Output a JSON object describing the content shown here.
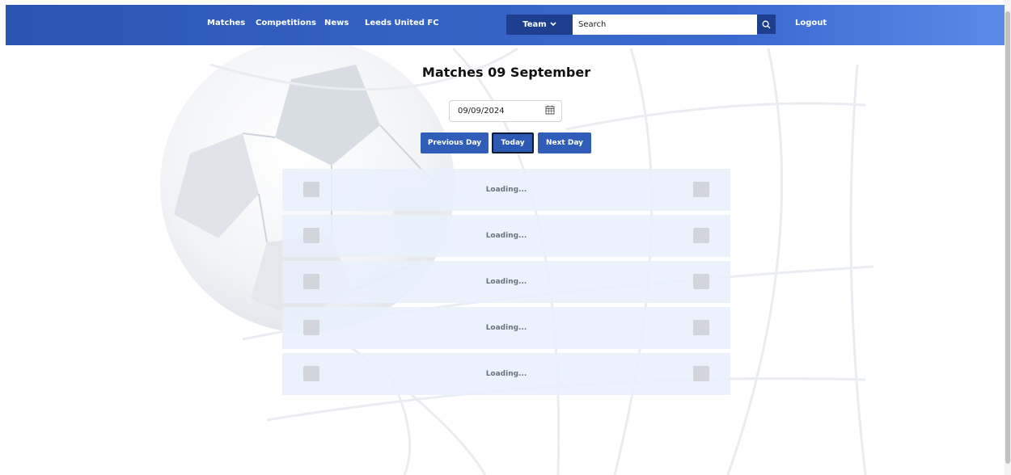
{
  "nav": {
    "links": [
      "Matches",
      "Competitions",
      "News",
      "Leeds United FC"
    ],
    "team_label": "Team",
    "search_placeholder": "Search",
    "logout_label": "Logout"
  },
  "page": {
    "title": "Matches 09 September",
    "date_value": "09/09/2024",
    "buttons": {
      "previous": "Previous Day",
      "today": "Today",
      "next": "Next Day"
    }
  },
  "matches": [
    {
      "status": "Loading..."
    },
    {
      "status": "Loading..."
    },
    {
      "status": "Loading..."
    },
    {
      "status": "Loading..."
    },
    {
      "status": "Loading..."
    }
  ],
  "icons": {
    "team": "chevron-down-icon",
    "search": "search-icon",
    "date": "calendar-icon"
  },
  "colors": {
    "nav_start": "#2a56b2",
    "nav_end": "#5a8be8",
    "button": "#2f5db8",
    "dark_button": "#1e3f8e",
    "row": "#e8f0fc",
    "placeholder_crest": "#d2d6dc"
  }
}
